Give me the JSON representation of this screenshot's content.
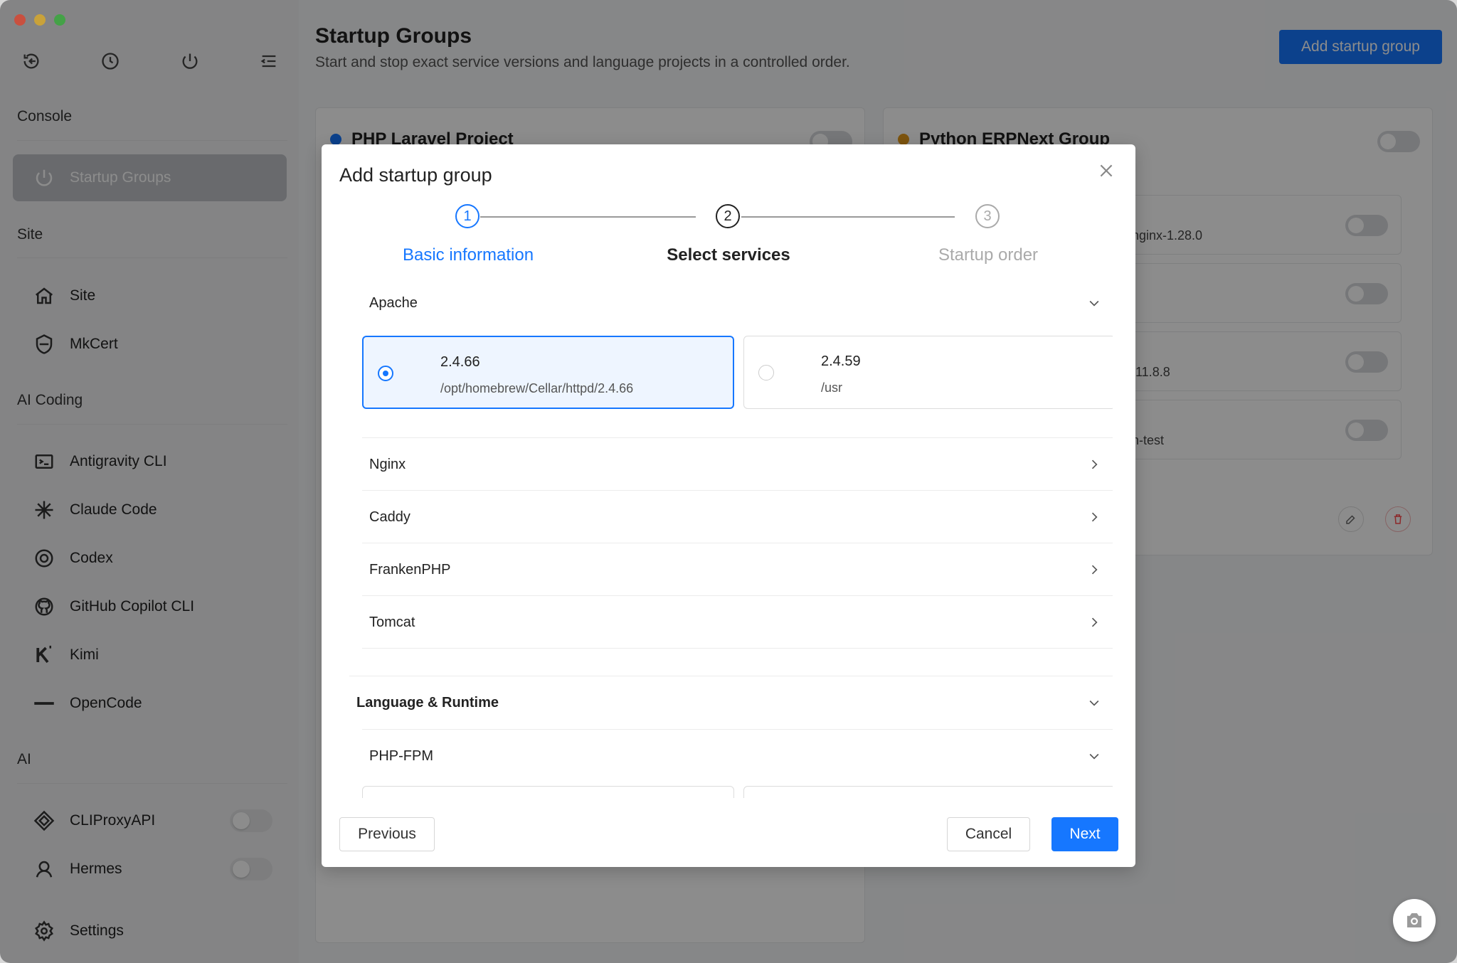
{
  "colors": {
    "accent": "#1677ff",
    "active_nav": "#bfc2c7",
    "dot_blue": "#1677ff",
    "dot_orange": "#e39a1b",
    "danger": "#ff4d4f"
  },
  "sidebar": {
    "toolbar_icons": [
      "back-icon",
      "history-icon",
      "power-icon",
      "menu-collapse-icon"
    ],
    "sections": {
      "console": "Console",
      "site": "Site",
      "ai_coding": "AI Coding",
      "ai": "AI"
    },
    "items": {
      "startup_groups": "Startup Groups",
      "site": "Site",
      "mkcert": "MkCert",
      "antigravity": "Antigravity CLI",
      "claude": "Claude Code",
      "codex": "Codex",
      "copilot": "GitHub Copilot CLI",
      "kimi": "Kimi",
      "opencode": "OpenCode",
      "cliproxy": "CLIProxyAPI",
      "hermes": "Hermes",
      "settings": "Settings"
    }
  },
  "header": {
    "title": "Startup Groups",
    "subtitle": "Start and stop exact service versions and language projects in a controlled order.",
    "add_button": "Add startup group"
  },
  "cards": {
    "left_title": "PHP Laravel Project",
    "right_title": "Python ERPNext Group",
    "right_rows": [
      "nginx-1.28.0",
      "",
      "/11.8.8",
      "n-test"
    ]
  },
  "modal": {
    "title": "Add startup group",
    "steps": [
      {
        "num": "1",
        "label": "Basic information"
      },
      {
        "num": "2",
        "label": "Select services"
      },
      {
        "num": "3",
        "label": "Startup order"
      }
    ],
    "apache": {
      "label": "Apache",
      "versions": [
        {
          "version": "2.4.66",
          "path": "/opt/homebrew/Cellar/httpd/2.4.66",
          "selected": true
        },
        {
          "version": "2.4.59",
          "path": "/usr",
          "selected": false
        }
      ]
    },
    "collapsed_groups": [
      "Nginx",
      "Caddy",
      "FrankenPHP",
      "Tomcat"
    ],
    "language_section": "Language & Runtime",
    "php_fpm": "PHP-FPM",
    "footer": {
      "previous": "Previous",
      "cancel": "Cancel",
      "next": "Next"
    }
  }
}
